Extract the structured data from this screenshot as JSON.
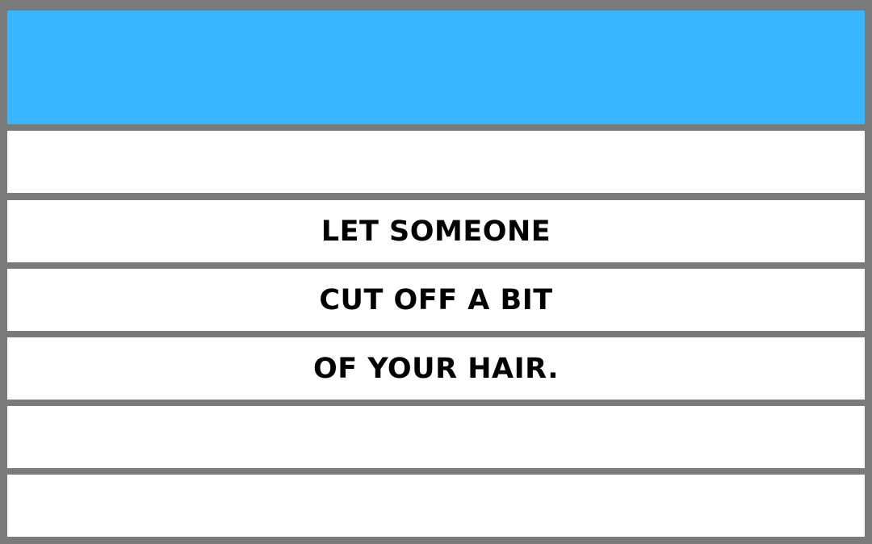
{
  "card": {
    "header_color": "#38b6ff",
    "frame_color": "#7a7a7a",
    "lines": [
      "",
      "LET SOMEONE",
      "CUT OFF A BIT",
      "OF YOUR HAIR.",
      "",
      ""
    ]
  }
}
